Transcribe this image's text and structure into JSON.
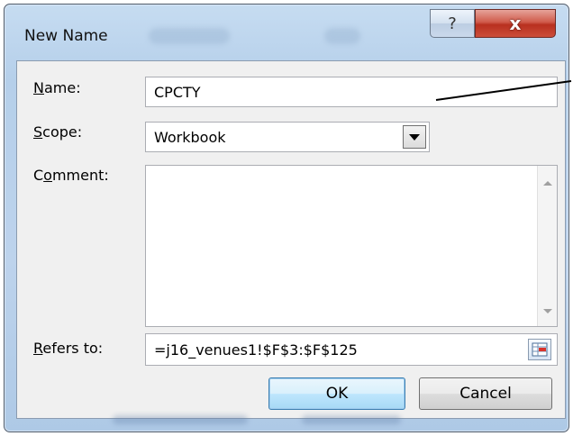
{
  "window": {
    "title": "New Name",
    "help_glyph": "?",
    "close_glyph": "x"
  },
  "form": {
    "name_label_prefix": "N",
    "name_label_rest": "ame:",
    "name_value": "CPCTY",
    "scope_label_prefix": "S",
    "scope_label_rest": "cope:",
    "scope_value": "Workbook",
    "comment_label_before": "C",
    "comment_label_accel": "o",
    "comment_label_after": "mment:",
    "comment_value": "",
    "refers_label_prefix": "R",
    "refers_label_rest": "efers to:",
    "refers_value": "=j16_venues1!$F$3:$F$125"
  },
  "buttons": {
    "ok_label": "OK",
    "cancel_label": "Cancel"
  },
  "icons": {
    "help": "help-icon",
    "close": "close-icon",
    "dropdown": "chevron-down-icon",
    "range_picker": "range-select-icon"
  },
  "colors": {
    "close_red": "#c8432f",
    "default_button_blue": "#3c7fb1",
    "frame_blue": "#bdd3ec"
  }
}
